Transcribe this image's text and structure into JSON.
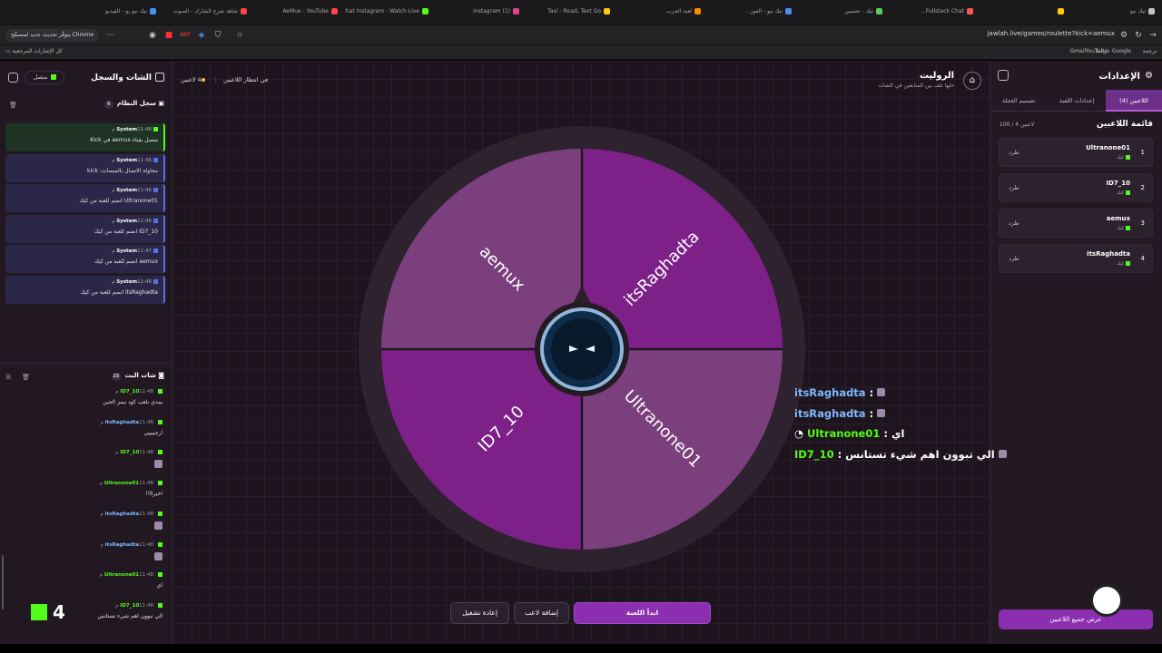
{
  "browser": {
    "tabs": [
      "تيك نيو",
      "",
      "Fullstack Chat...",
      "تيك - تحسين",
      "تيك نيو - الفوز...",
      "لعبة الحرب",
      "Taxi - Road, Text Go",
      "instagram (1)",
      "chat Instagram - Watch Live",
      "AeMux - YouTube",
      "شاهد شرح الشارك - الصوت",
      "تيك نيو يو - الفيديو"
    ],
    "update_label": "يتوفّر تحديث جديد لمتصفّح Chrome",
    "url": "jawlah.live/games/roulette?kick=aemux",
    "bookmarks": {
      "all": "كل الإشارات المرجعية",
      "gmail": "Gmail",
      "youtube": "YouTube",
      "maps": "خرائط Google",
      "translate": "ترجمة"
    }
  },
  "settings": {
    "title": "الإعدادات",
    "tabs": [
      "اللاعبين (4)",
      "إعدادات اللعبة",
      "تصميم العجلة"
    ],
    "list_title": "قائمة اللاعبين",
    "list_count": "100 / 4 لاعبين",
    "kick_label": "طرد",
    "platform_label": "كيك",
    "players": [
      {
        "num": "1",
        "name": "Ultranone01"
      },
      {
        "num": "2",
        "name": "ID7_10"
      },
      {
        "num": "3",
        "name": "aemux"
      },
      {
        "num": "4",
        "name": "itsRaghadta"
      }
    ],
    "show_all": "عرض جميع اللاعبين"
  },
  "game": {
    "title": "الروليت",
    "subtitle": "خلها تلف بين المتابعين في الشات",
    "players_count": "4 لاعبين",
    "waiting": "في انتظار اللاعبين",
    "wheel_colors": {
      "light": "#7a3f7c",
      "dark": "#7d2189",
      "rim": "#2e222f",
      "hub": "#0e2c4a"
    },
    "segments": [
      {
        "name": "aemux",
        "shade": "light"
      },
      {
        "name": "itsRaghadta",
        "shade": "dark"
      },
      {
        "name": "Ultranone01",
        "shade": "light"
      },
      {
        "name": "ID7_10",
        "shade": "dark"
      }
    ],
    "overlay": [
      {
        "name": "itsRaghadta",
        "sep": " :",
        "msg": ""
      },
      {
        "name": "itsRaghadta",
        "sep": " :",
        "msg": ""
      },
      {
        "name": "Ultranone01",
        "sep": " : ",
        "msg": "اي"
      },
      {
        "name": "ID7_10",
        "sep": " : ",
        "msg": "الي تبوون اهم شيء تستانس"
      }
    ],
    "buttons": {
      "start": "ابدأ اللعبة",
      "add": "إضافة لاعب",
      "reset": "إعادة تشغيل"
    }
  },
  "chat": {
    "title": "الشات والسجل",
    "status": "متصل",
    "system_log": {
      "title": "سجل النظام",
      "count": "6"
    },
    "system_messages": [
      {
        "who": "System",
        "time": "11:46 م",
        "text": "متصل بقناة aemux في Kick",
        "green": true
      },
      {
        "who": "System",
        "time": "11:46 م",
        "text": "محاولة الاتصال بالمنصات: kick",
        "green": false
      },
      {
        "who": "System",
        "time": "11:46 م",
        "text": "Ultranone01 انضم للعبة من كيك",
        "green": false
      },
      {
        "who": "System",
        "time": "11:46 م",
        "text": "ID7_10 انضم للعبة من كيك",
        "green": false
      },
      {
        "who": "System",
        "time": "11:47 م",
        "text": "aemux انضم للعبة من كيك",
        "green": false
      },
      {
        "who": "System",
        "time": "11:48 م",
        "text": "itsRaghadta انضم للعبة من كيك",
        "green": false
      }
    ],
    "live_chat": {
      "title": "شات البث",
      "count": "25"
    },
    "messages": [
      {
        "name": "ID7_10",
        "time": "11:48 م",
        "text": "يمدي نلعب كود نيمز الحين",
        "emoji": false,
        "green": true
      },
      {
        "name": "itsRaghadta",
        "time": "11:48 م",
        "text": "ارجبيييي",
        "emoji": false,
        "green": false
      },
      {
        "name": "ID7_10",
        "time": "11:48 م",
        "text": "",
        "emoji": true,
        "green": true
      },
      {
        "name": "Ultranone01",
        "time": "11:48 م",
        "text": "اخيراا!!",
        "emoji": false,
        "green": true
      },
      {
        "name": "itsRaghadta",
        "time": "11:48 م",
        "text": "",
        "emoji": true,
        "green": false
      },
      {
        "name": "itsRaghadta",
        "time": "11:48 م",
        "text": "",
        "emoji": true,
        "green": false
      },
      {
        "name": "Ultranone01",
        "time": "11:48 م",
        "text": "اي",
        "emoji": false,
        "green": true
      },
      {
        "name": "ID7_10",
        "time": "11:48 م",
        "text": "الي تبوون اهم شيء تستانس",
        "emoji": false,
        "green": true
      }
    ],
    "viewer_count": "4"
  }
}
